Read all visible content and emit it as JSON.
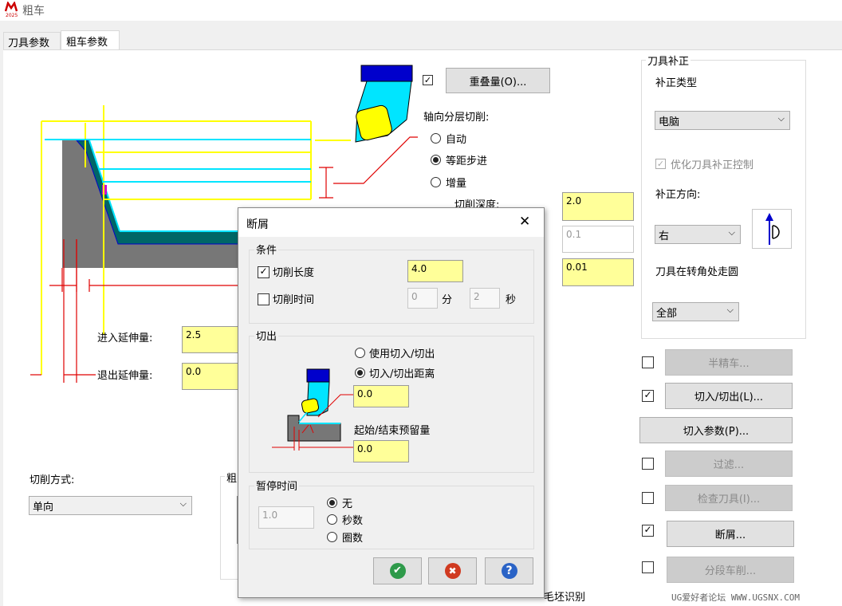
{
  "window": {
    "title": "粗车",
    "logo_text": "2025"
  },
  "tabs": [
    {
      "label": "刀具参数"
    },
    {
      "label": "粗车参数"
    }
  ],
  "main": {
    "overlap_label": "重叠量(O)...",
    "axial_layer_cut_label": "轴向分层切削:",
    "axial_options": [
      "自动",
      "等距步进",
      "增量"
    ],
    "axial_selected": 1,
    "cut_depth_label": "切削深度:",
    "cut_depth_value": "2.0",
    "field_two_value": "0.1",
    "field_three_value": "0.01",
    "entry_ext_label": "进入延伸量:",
    "entry_ext_value": "2.5",
    "exit_ext_label": "退出延伸量:",
    "exit_ext_value": "0.0",
    "cut_method_label": "切削方式:",
    "cut_method_value": "单向",
    "rough_group_label": "粗",
    "stock_recognition_label": "毛坯识别"
  },
  "tool_comp": {
    "title": "刀具补正",
    "comp_type_label": "补正类型",
    "comp_type_value": "电脑",
    "optimize_label": "优化刀具补正控制",
    "comp_dir_label": "补正方向:",
    "comp_dir_value": "右",
    "corner_label": "刀具在转角处走圆",
    "corner_value": "全部"
  },
  "side_buttons": [
    {
      "label": "半精车...",
      "checked": false,
      "enabled": false
    },
    {
      "label": "切入/切出(L)...",
      "checked": true,
      "enabled": true
    },
    {
      "label": "切入参数(P)...",
      "checked": null,
      "enabled": true
    },
    {
      "label": "过滤...",
      "checked": false,
      "enabled": false
    },
    {
      "label": "检查刀具(I)...",
      "checked": false,
      "enabled": false
    },
    {
      "label": "断屑...",
      "checked": true,
      "enabled": true
    },
    {
      "label": "分段车削...",
      "checked": false,
      "enabled": false
    }
  ],
  "dialog": {
    "title": "断屑",
    "close_glyph": "✕",
    "conditions_title": "条件",
    "cut_length_label": "切削长度",
    "cut_length_checked": true,
    "cut_length_value": "4.0",
    "cut_time_label": "切削时间",
    "cut_time_checked": false,
    "minutes_value": "0",
    "minutes_unit": "分",
    "seconds_value": "2",
    "seconds_unit": "秒",
    "retract_title": "切出",
    "use_entry_exit_label": "使用切入/切出",
    "entry_exit_dist_label": "切入/切出距离",
    "retract_selected": 1,
    "entry_exit_dist_value": "0.0",
    "start_end_allow_label": "起始/结束预留量",
    "start_end_allow_value": "0.0",
    "dwell_title": "暂停时间",
    "dwell_value": "1.0",
    "dwell_options": [
      "无",
      "秒数",
      "圈数"
    ],
    "dwell_selected": 0,
    "ok_glyph": "✔",
    "cancel_glyph": "✖",
    "help_glyph": "?"
  },
  "watermark": "UG爱好者论坛  WWW.UGSNX.COM",
  "colors": {
    "field_yellow": "#ffff99",
    "tool_blue": "#0000cc",
    "tool_cyan": "#00e5ff",
    "tool_yellow": "#ffff00",
    "part_gray": "#777777",
    "ok_green": "#2e9a4a",
    "cancel_red": "#d03a20",
    "help_blue": "#2a63c6"
  }
}
